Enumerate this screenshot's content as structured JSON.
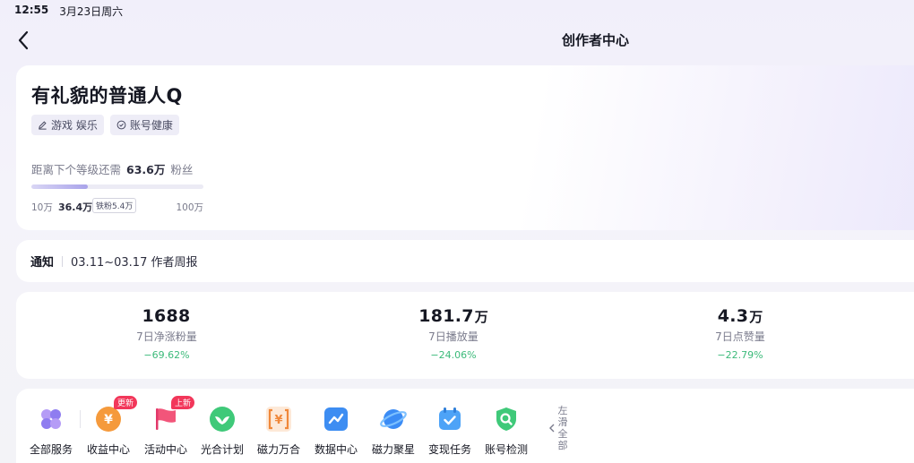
{
  "status_bar": {
    "time": "12:55",
    "date": "3月23日周六"
  },
  "nav": {
    "title": "创作者中心",
    "back_icon": "chevron-left-icon"
  },
  "profile": {
    "name": "有礼貌的普通人Q",
    "tags": [
      {
        "icon": "edit-icon",
        "label": "游戏 娱乐"
      },
      {
        "icon": "check-circle-icon",
        "label": "账号健康"
      }
    ],
    "level_prefix": "距离下个等级还需",
    "level_value": "63.6万",
    "level_suffix": "粉丝",
    "progress_fraction": 0.33,
    "progress_start": "10万",
    "progress_current": "36.4万",
    "progress_badge": "铁粉5.4万",
    "progress_end": "100万"
  },
  "notice": {
    "label": "通知",
    "text": "03.11~03.17 作者周报"
  },
  "stats": [
    {
      "value": "1688",
      "unit": "",
      "label": "7日净涨粉量",
      "change": "−69.62%"
    },
    {
      "value": "181.7",
      "unit": "万",
      "label": "7日播放量",
      "change": "−24.06%"
    },
    {
      "value": "4.3",
      "unit": "万",
      "label": "7日点赞量",
      "change": "−22.79%"
    }
  ],
  "services": [
    {
      "label": "全部服务",
      "icon": "grid-flower-icon",
      "badge": ""
    },
    {
      "label": "收益中心",
      "icon": "yuan-coin-icon",
      "badge": "更新"
    },
    {
      "label": "活动中心",
      "icon": "flag-icon",
      "badge": "上新"
    },
    {
      "label": "光合计划",
      "icon": "leaf-icon",
      "badge": ""
    },
    {
      "label": "磁力万合",
      "icon": "yuan-bracket-icon",
      "badge": ""
    },
    {
      "label": "数据中心",
      "icon": "chart-line-icon",
      "badge": ""
    },
    {
      "label": "磁力聚星",
      "icon": "planet-icon",
      "badge": ""
    },
    {
      "label": "变现任务",
      "icon": "calendar-check-icon",
      "badge": ""
    },
    {
      "label": "账号检测",
      "icon": "shield-search-icon",
      "badge": ""
    }
  ],
  "slide_hint": "左滑全部",
  "colors": {
    "positive_change": "#3cba7a",
    "badge": "#f2375a",
    "accent": "#a9a3ea"
  }
}
